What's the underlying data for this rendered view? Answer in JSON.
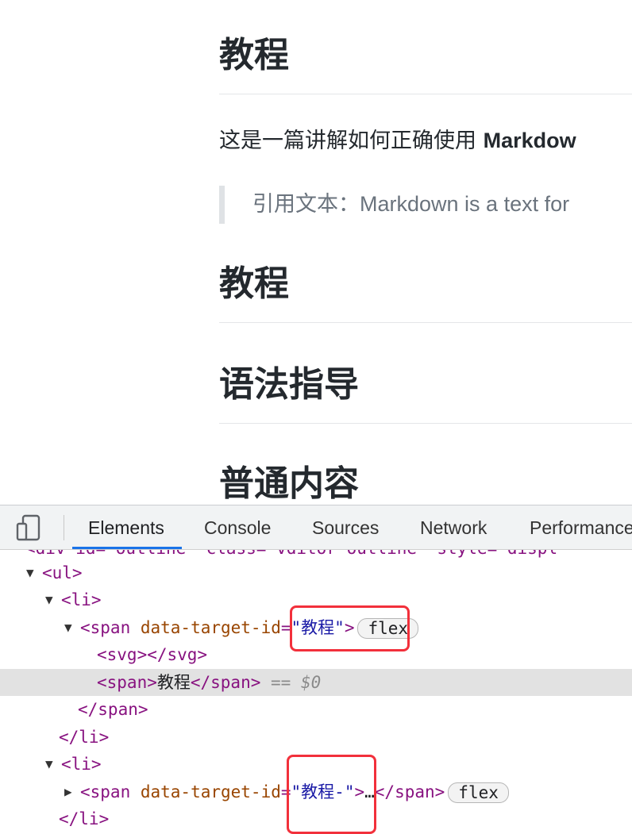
{
  "page": {
    "headings": [
      "教程",
      "教程",
      "语法指导",
      "普通内容"
    ],
    "paragraph": {
      "prefix": "这是一篇讲解如何正确使用 ",
      "bold": "Markdow"
    },
    "quote": {
      "label": "引用文本：",
      "text": "Markdown is a text for"
    }
  },
  "devtools": {
    "tabs": [
      "Elements",
      "Console",
      "Sources",
      "Network",
      "Performance"
    ],
    "active_tab": "Elements",
    "tree": {
      "cut_line": "<div id=\"outline\" class=\"vditor-outline\" style=\"displ",
      "ul_open": "<ul>",
      "li_open": "<li>",
      "span_open_start": "<span ",
      "attr_name": "data-target-id",
      "eq": "=",
      "attr_value_1": "\"教程\"",
      "attr_value_2": "\"教程-\"",
      "close_bracket": ">",
      "badge": "flex",
      "svg_line": "<svg></svg>",
      "span_inner_open": "<span>",
      "span_inner_text": "教程",
      "span_inner_close": "</span>",
      "selected_suffix": "==",
      "dollar": "$0",
      "span_close": "</span>",
      "li_close": "</li>",
      "ellipsis": "…"
    },
    "highlight_color": "#f2303b",
    "accent_color": "#1a73e8"
  }
}
